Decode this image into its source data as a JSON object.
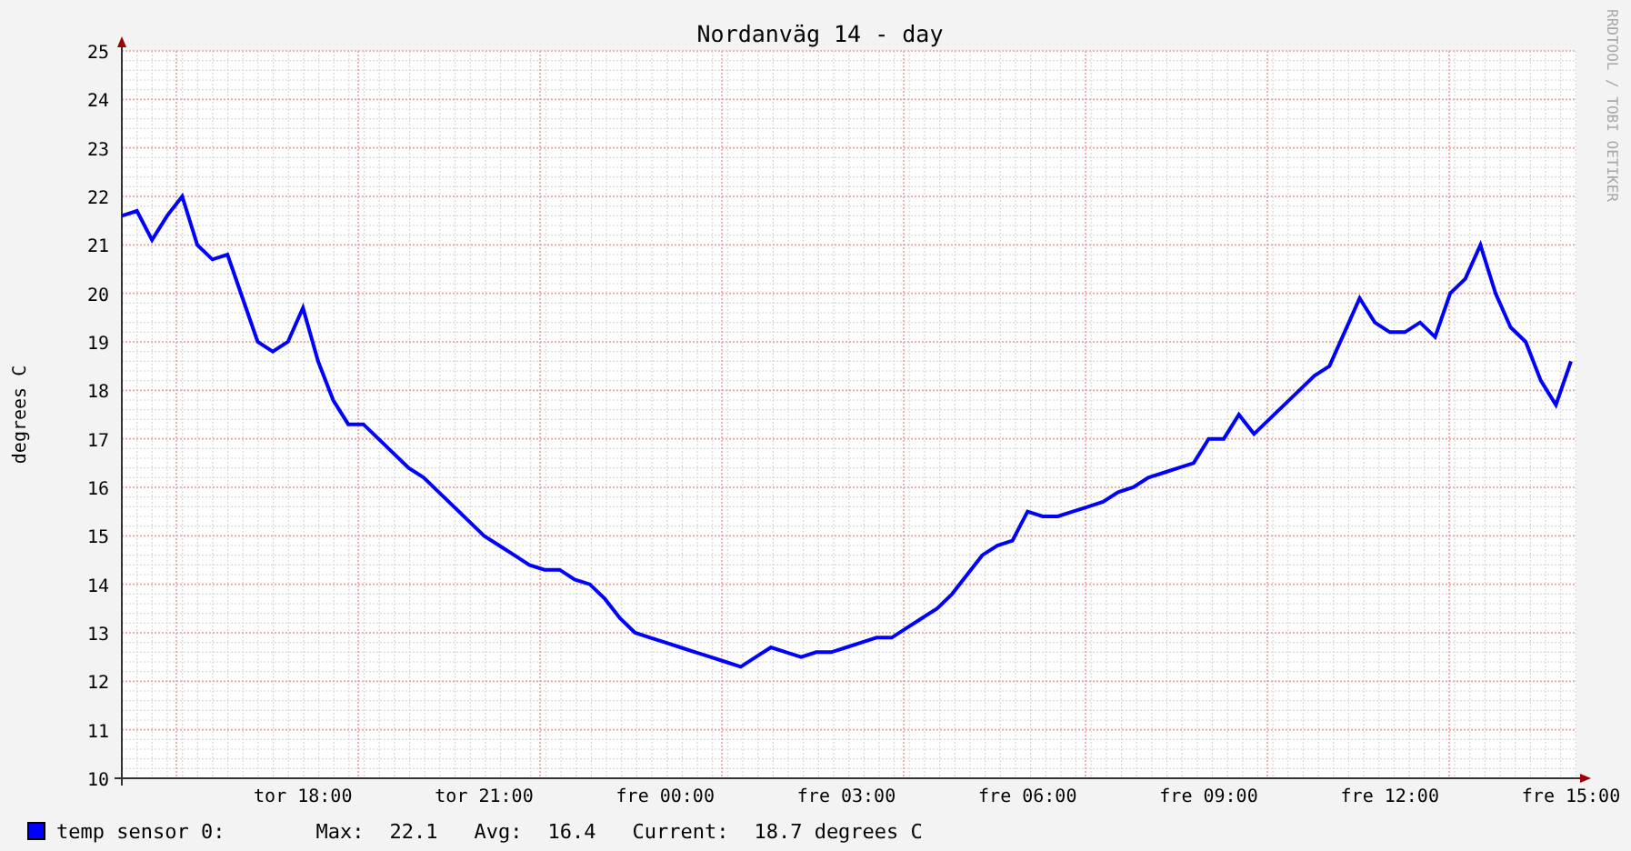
{
  "graph": {
    "title": "Nordanväg 14 - day",
    "side_text": "RRDTOOL / TOBI OETIKER",
    "chart_data": {
      "type": "line",
      "ylabel": "degrees C",
      "categories": [
        null,
        null,
        null,
        null,
        null,
        null,
        null,
        null,
        null,
        null,
        null,
        null,
        "tor 18:00",
        null,
        null,
        null,
        null,
        null,
        null,
        null,
        null,
        null,
        null,
        null,
        "tor 21:00",
        null,
        null,
        null,
        null,
        null,
        null,
        null,
        null,
        null,
        null,
        null,
        "fre 00:00",
        null,
        null,
        null,
        null,
        null,
        null,
        null,
        null,
        null,
        null,
        null,
        "fre 03:00",
        null,
        null,
        null,
        null,
        null,
        null,
        null,
        null,
        null,
        null,
        null,
        "fre 06:00",
        null,
        null,
        null,
        null,
        null,
        null,
        null,
        null,
        null,
        null,
        null,
        "fre 09:00",
        null,
        null,
        null,
        null,
        null,
        null,
        null,
        null,
        null,
        null,
        null,
        "fre 12:00",
        null,
        null,
        null,
        null,
        null,
        null,
        null,
        null,
        null,
        null,
        null,
        "fre 15:00"
      ],
      "series": [
        {
          "name": "temp sensor 0:",
          "color": "#0000ff",
          "values": [
            21.6,
            21.7,
            21.1,
            21.6,
            22.0,
            21.0,
            20.7,
            20.8,
            19.9,
            19.0,
            18.8,
            19.0,
            19.7,
            18.6,
            17.8,
            17.3,
            17.3,
            17.0,
            16.7,
            16.4,
            16.2,
            15.9,
            15.6,
            15.3,
            15.0,
            14.8,
            14.6,
            14.4,
            14.3,
            14.3,
            14.1,
            14.0,
            13.7,
            13.3,
            13.0,
            12.9,
            12.8,
            12.7,
            12.6,
            12.5,
            12.4,
            12.3,
            12.5,
            12.7,
            12.6,
            12.5,
            12.6,
            12.6,
            12.7,
            12.8,
            12.9,
            12.9,
            13.1,
            13.3,
            13.5,
            13.8,
            14.2,
            14.6,
            14.8,
            14.9,
            15.5,
            15.4,
            15.4,
            15.5,
            15.6,
            15.7,
            15.9,
            16.0,
            16.2,
            16.3,
            16.4,
            16.5,
            17.0,
            17.0,
            17.5,
            17.1,
            17.4,
            17.7,
            18.0,
            18.3,
            18.5,
            19.2,
            19.9,
            19.4,
            19.2,
            19.2,
            19.4,
            19.1,
            20.0,
            20.3,
            21.0,
            20.0,
            19.3,
            19.0,
            18.2,
            17.7,
            18.6
          ]
        }
      ],
      "grid": true,
      "ylim": [
        10,
        25
      ],
      "yticks": [
        10,
        11,
        12,
        13,
        14,
        15,
        16,
        17,
        18,
        19,
        20,
        21,
        22,
        23,
        24,
        25
      ]
    }
  },
  "legend": {
    "stats": [
      {
        "label": "Max:",
        "value": "22.1"
      },
      {
        "label": "Avg:",
        "value": "16.4"
      },
      {
        "label": "Current:",
        "value": "18.7 degrees C"
      }
    ]
  }
}
